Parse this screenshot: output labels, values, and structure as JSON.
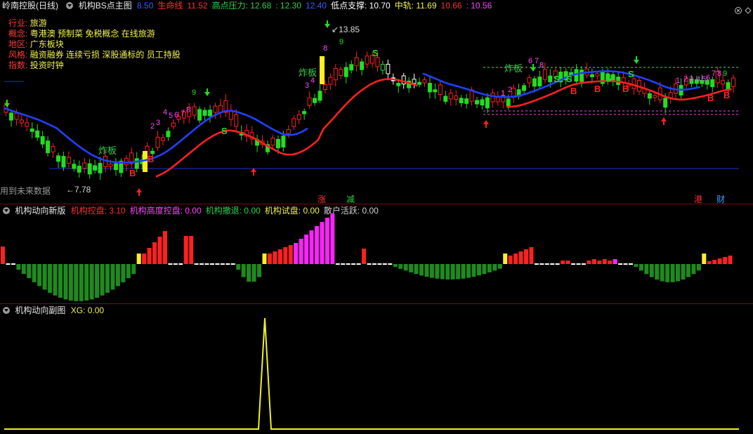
{
  "main": {
    "title": "岭南控股(日线)",
    "indicator": "机构BS点主图",
    "values": [
      {
        "text": "8.50",
        "color": "#3a5aff"
      },
      {
        "text": "生命线",
        "color": "#ff3030"
      },
      {
        "text": "11.52",
        "color": "#ff3030"
      },
      {
        "text": "高点压力: 12.68",
        "color": "#2ed14b"
      },
      {
        "text": ": 12.30",
        "color": "#2ed14b"
      },
      {
        "text": "12.40",
        "color": "#3a5aff"
      },
      {
        "text": "低点支撑: 10.70",
        "color": "#ffffff"
      },
      {
        "text": "中轨: 11.69",
        "color": "#f0f050"
      },
      {
        "text": "10.66",
        "color": "#ff3030"
      },
      {
        "text": ": 10.56",
        "color": "#ff44ff"
      }
    ],
    "info": [
      {
        "key": "行业:",
        "val": "旅游"
      },
      {
        "key": "概念:",
        "val": "粤港澳 预制菜 免税概念 在线旅游"
      },
      {
        "key": "地区:",
        "val": "广东板块"
      },
      {
        "key": "风格:",
        "val": "融资融券 连续亏损 深股通标的 员工持股"
      },
      {
        "key": "指数:",
        "val": "投资时钟"
      }
    ],
    "high_label": "13.85",
    "low_label": "7.78",
    "future_note": "用到未来数据",
    "zhaban": "炸板",
    "tags": {
      "zhang": "涨",
      "jian": "减",
      "gang": "港",
      "cai": "财"
    }
  },
  "sub1": {
    "title": "机构动向新版",
    "values": [
      {
        "text": "机构控盘: 3.10",
        "color": "#ff3030"
      },
      {
        "text": "机构高度控盘: 0.00",
        "color": "#ff44ff"
      },
      {
        "text": "机构撤退: 0.00",
        "color": "#2ed14b"
      },
      {
        "text": "机构试盘: 0.00",
        "color": "#f0f050"
      },
      {
        "text": "散户活跃: 0.00",
        "color": "#d0d0d0"
      }
    ]
  },
  "sub2": {
    "title": "机构动向副图",
    "values": [
      {
        "text": "XG: 0.00",
        "color": "#f0f050"
      }
    ]
  },
  "colors": {
    "up": "#ff2020",
    "down": "#22dd22",
    "bg": "#000000",
    "divider": "#7a0b12"
  }
}
